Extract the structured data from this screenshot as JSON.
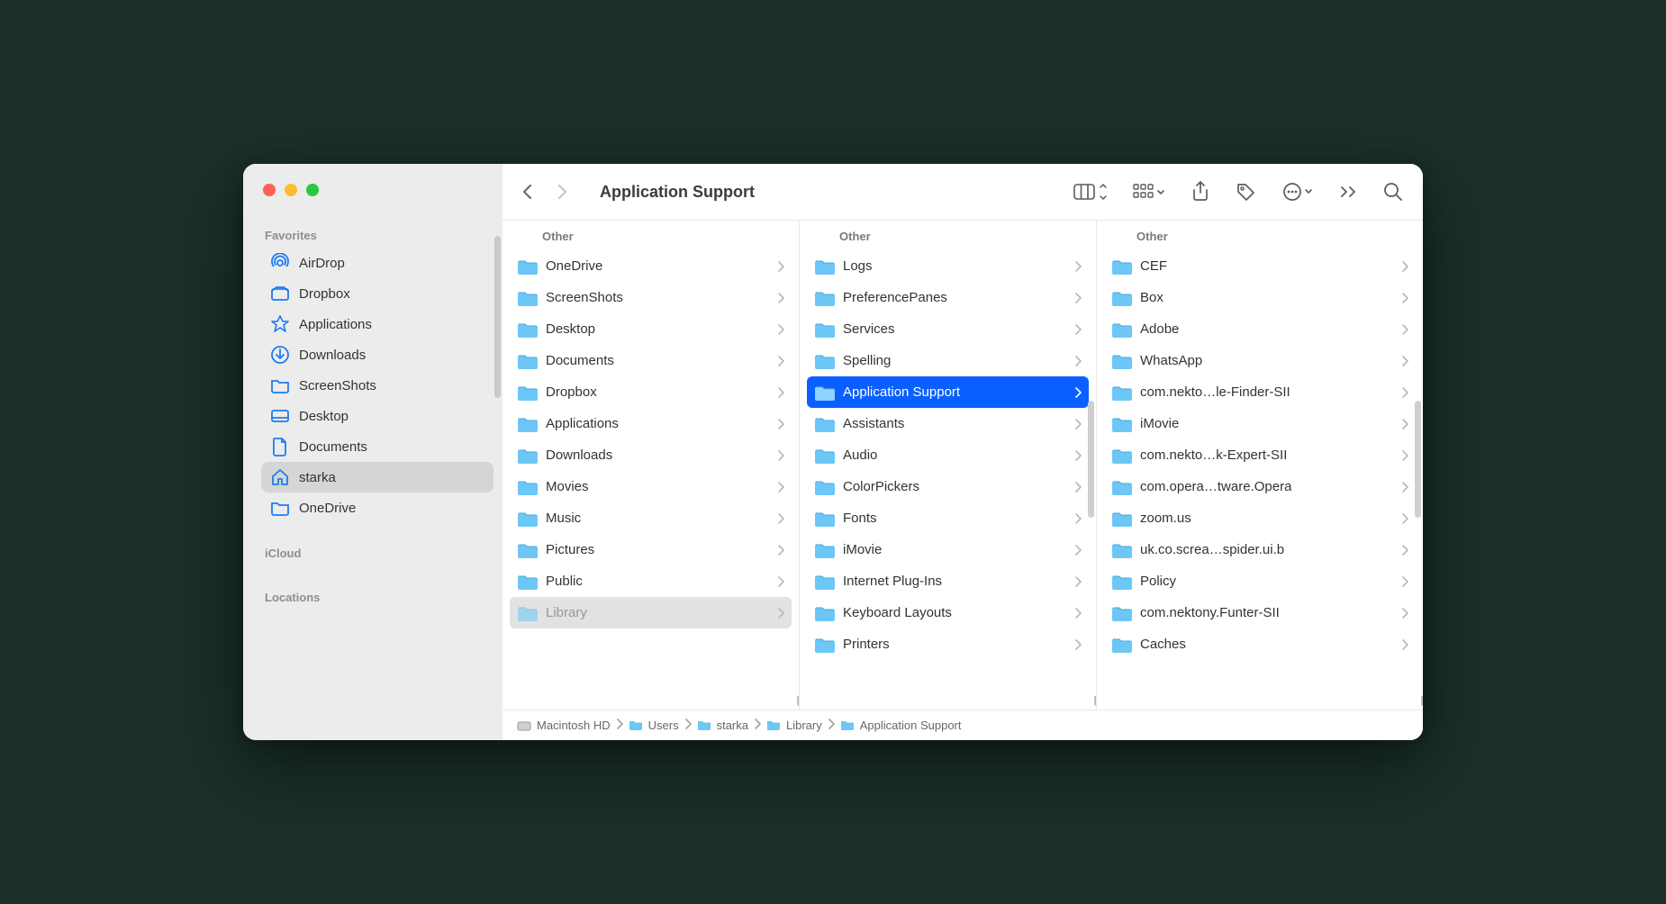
{
  "window": {
    "title": "Application Support"
  },
  "sidebar": {
    "sections": {
      "favorites": "Favorites",
      "icloud": "iCloud",
      "locations": "Locations"
    },
    "items": [
      {
        "label": "AirDrop",
        "icon": "airdrop"
      },
      {
        "label": "Dropbox",
        "icon": "dropbox"
      },
      {
        "label": "Applications",
        "icon": "apps"
      },
      {
        "label": "Downloads",
        "icon": "downloads"
      },
      {
        "label": "ScreenShots",
        "icon": "folder"
      },
      {
        "label": "Desktop",
        "icon": "desktop"
      },
      {
        "label": "Documents",
        "icon": "doc"
      },
      {
        "label": "starka",
        "icon": "home",
        "selected": true
      },
      {
        "label": "OneDrive",
        "icon": "folder"
      }
    ]
  },
  "columns": [
    {
      "header": "Other",
      "items": [
        {
          "label": "OneDrive"
        },
        {
          "label": "ScreenShots"
        },
        {
          "label": "Desktop"
        },
        {
          "label": "Documents"
        },
        {
          "label": "Dropbox"
        },
        {
          "label": "Applications"
        },
        {
          "label": "Downloads"
        },
        {
          "label": "Movies"
        },
        {
          "label": "Music"
        },
        {
          "label": "Pictures"
        },
        {
          "label": "Public"
        },
        {
          "label": "Library",
          "dim": true
        }
      ]
    },
    {
      "header": "Other",
      "items": [
        {
          "label": "Logs"
        },
        {
          "label": "PreferencePanes"
        },
        {
          "label": "Services"
        },
        {
          "label": "Spelling"
        },
        {
          "label": "Application Support",
          "selected": true
        },
        {
          "label": "Assistants"
        },
        {
          "label": "Audio"
        },
        {
          "label": "ColorPickers"
        },
        {
          "label": "Fonts"
        },
        {
          "label": "iMovie"
        },
        {
          "label": "Internet Plug-Ins"
        },
        {
          "label": "Keyboard Layouts"
        },
        {
          "label": "Printers"
        }
      ],
      "scroll": true
    },
    {
      "header": "Other",
      "items": [
        {
          "label": "CEF"
        },
        {
          "label": "Box"
        },
        {
          "label": "Adobe"
        },
        {
          "label": "WhatsApp"
        },
        {
          "label": "com.nekto…le-Finder-SII"
        },
        {
          "label": "iMovie"
        },
        {
          "label": "com.nekto…k-Expert-SII"
        },
        {
          "label": "com.opera…tware.Opera"
        },
        {
          "label": "zoom.us"
        },
        {
          "label": "uk.co.screa…spider.ui.b"
        },
        {
          "label": "Policy"
        },
        {
          "label": "com.nektony.Funter-SII"
        },
        {
          "label": "Caches"
        }
      ],
      "scroll": true
    }
  ],
  "path": [
    {
      "label": "Macintosh HD",
      "icon": "disk"
    },
    {
      "label": "Users",
      "icon": "folder"
    },
    {
      "label": "starka",
      "icon": "folder"
    },
    {
      "label": "Library",
      "icon": "folder"
    },
    {
      "label": "Application Support",
      "icon": "folder"
    }
  ]
}
